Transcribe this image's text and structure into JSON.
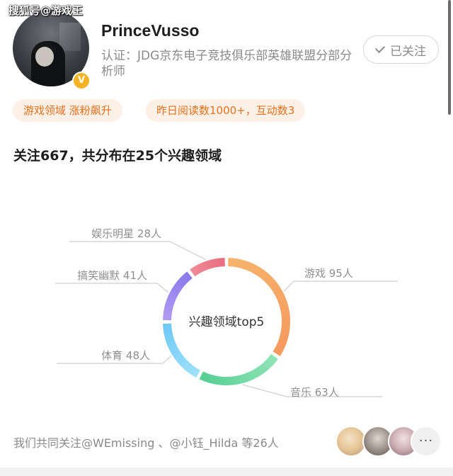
{
  "watermark": "搜狐号@游戏王",
  "profile": {
    "username": "PrinceVusso",
    "certification": "认证：JDG京东电子竞技俱乐部英雄联盟分部分析师",
    "follow_button": "已关注",
    "tags": [
      "游戏领域 涨粉飙升",
      "昨日阅读数1000+，互动数3"
    ]
  },
  "summary": "关注667，共分布在25个兴趣领域",
  "chart_data": {
    "type": "pie",
    "title": "兴趣领域top5",
    "categories": [
      "游戏",
      "音乐",
      "体育",
      "搞笑幽默",
      "娱乐明星"
    ],
    "values": [
      95,
      63,
      48,
      41,
      28
    ],
    "unit": "人",
    "labels": [
      "游戏 95人",
      "音乐 63人",
      "体育 48人",
      "搞笑幽默 41人",
      "娱乐明星 28人"
    ],
    "colors": [
      [
        "#f7b36b",
        "#f59a5f"
      ],
      [
        "#8fe3b7",
        "#56cf93"
      ],
      [
        "#9ee1fa",
        "#6ec9f5"
      ],
      [
        "#b19bf2",
        "#8a79ea"
      ],
      [
        "#f08a98",
        "#e96d7d"
      ]
    ]
  },
  "footer": {
    "text": "我们共同关注@WEmissing 、@小钰_Hilda 等26人",
    "more_label": "···"
  }
}
